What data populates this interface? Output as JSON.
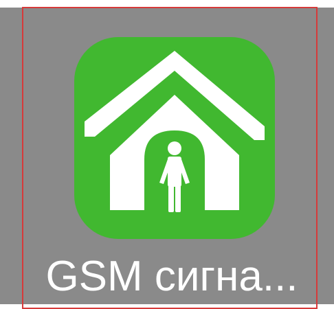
{
  "app": {
    "label": "GSM сигна...",
    "icon": "house-with-person-icon"
  },
  "colors": {
    "background": "#8a8a8a",
    "icon_background": "#41b830",
    "icon_foreground": "#ffffff",
    "highlight_border": "#d63a3a",
    "label_text": "#ffffff"
  }
}
